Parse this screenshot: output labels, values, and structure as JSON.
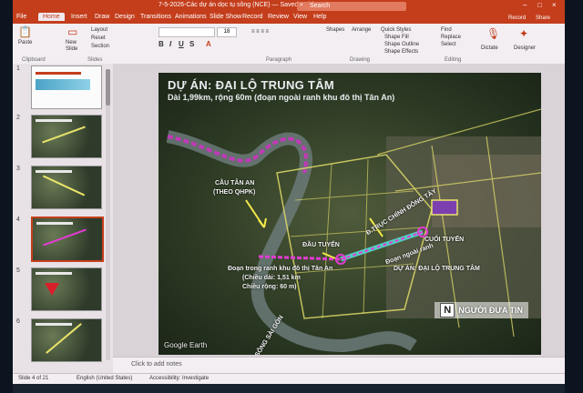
{
  "window": {
    "title": "7-5-2026-Các dự án dọc tụ sông (NCE) — Saved to this PC",
    "search_placeholder": "Search"
  },
  "tabs": [
    "File",
    "Home",
    "Insert",
    "Draw",
    "Design",
    "Transitions",
    "Animations",
    "Slide Show",
    "Record",
    "Review",
    "View",
    "Help"
  ],
  "ribbon": {
    "paste": "Paste",
    "new": "New",
    "slide": "Slide",
    "layout": "Layout",
    "reset": "Reset",
    "section": "Section",
    "clipboard": "Clipboard",
    "slides_group": "Slides",
    "font_size": "18",
    "paragraph": "Paragraph",
    "drawing": "Drawing",
    "editing": "Editing",
    "shapes": "Shapes",
    "arrange": "Arrange",
    "quick_styles": "Quick Styles",
    "shape_fill": "Shape Fill",
    "shape_outline": "Shape Outline",
    "shape_effects": "Shape Effects",
    "find": "Find",
    "replace": "Replace",
    "select": "Select",
    "dictate": "Dictate",
    "designer": "Designer",
    "record": "Record",
    "share": "Share"
  },
  "thumbnails": [
    {
      "num": "1"
    },
    {
      "num": "2"
    },
    {
      "num": "3"
    },
    {
      "num": "4"
    },
    {
      "num": "5"
    },
    {
      "num": "6"
    }
  ],
  "slide": {
    "title": "DỰ ÁN: ĐẠI LỘ TRUNG TÂM",
    "subtitle": "Dài 1,99km, rộng 60m (đoạn ngoài ranh khu đô thị Tân An)",
    "labels": {
      "cau_tan_an": "CẦU TÂN AN",
      "theo_qhpk": "(THEO QHPK)",
      "truc_chinh": "Đ.TRỤC CHÍNH ĐÔNG TÂY",
      "dau_tuyen": "ĐẦU TUYẾN",
      "cuoi_tuyen": "CUỐI TUYẾN",
      "doan_trong": "Đoạn trong ranh khu đô thị Tân An",
      "chieu_dai": "(Chiều dài: 1,51 km",
      "chieu_rong": "Chiều rộng: 60 m)",
      "dai_lo": "DỰ ÁN: ĐẠI LỘ TRUNG TÂM",
      "doan_ngoai": "Đoạn ngoài ranh",
      "ven_song": "Đ.VEN SÔNG SÀI GÒN",
      "google_earth": "Google Earth"
    }
  },
  "watermark": {
    "letter": "N",
    "text": "NGƯỜI ĐƯA TIN"
  },
  "notes": {
    "placeholder": "Click to add notes"
  },
  "status": {
    "slide": "Slide 4 of 21",
    "language": "English (United States)",
    "accessibility": "Accessibility: Investigate"
  },
  "colors": {
    "accent": "#c43e1c",
    "road": "#e9e36a",
    "route": "#e33bd4",
    "river_path": "#c03ab7"
  }
}
